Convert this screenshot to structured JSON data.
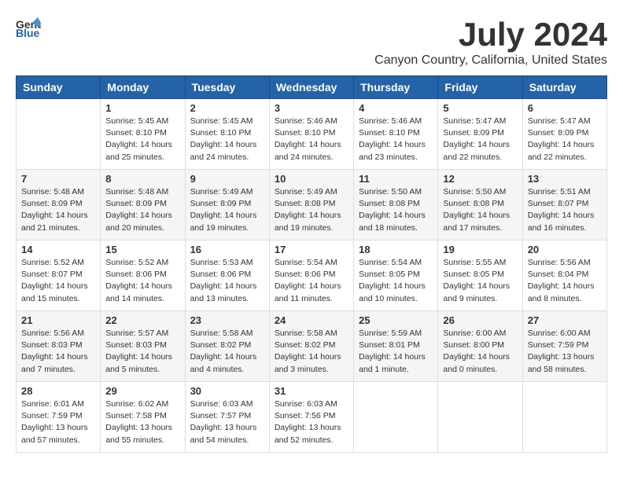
{
  "header": {
    "logo": {
      "line1": "General",
      "line2": "Blue"
    },
    "title": "July 2024",
    "subtitle": "Canyon Country, California, United States"
  },
  "days_of_week": [
    "Sunday",
    "Monday",
    "Tuesday",
    "Wednesday",
    "Thursday",
    "Friday",
    "Saturday"
  ],
  "weeks": [
    [
      {
        "day": "",
        "info": ""
      },
      {
        "day": "1",
        "info": "Sunrise: 5:45 AM\nSunset: 8:10 PM\nDaylight: 14 hours\nand 25 minutes."
      },
      {
        "day": "2",
        "info": "Sunrise: 5:45 AM\nSunset: 8:10 PM\nDaylight: 14 hours\nand 24 minutes."
      },
      {
        "day": "3",
        "info": "Sunrise: 5:46 AM\nSunset: 8:10 PM\nDaylight: 14 hours\nand 24 minutes."
      },
      {
        "day": "4",
        "info": "Sunrise: 5:46 AM\nSunset: 8:10 PM\nDaylight: 14 hours\nand 23 minutes."
      },
      {
        "day": "5",
        "info": "Sunrise: 5:47 AM\nSunset: 8:09 PM\nDaylight: 14 hours\nand 22 minutes."
      },
      {
        "day": "6",
        "info": "Sunrise: 5:47 AM\nSunset: 8:09 PM\nDaylight: 14 hours\nand 22 minutes."
      }
    ],
    [
      {
        "day": "7",
        "info": "Sunrise: 5:48 AM\nSunset: 8:09 PM\nDaylight: 14 hours\nand 21 minutes."
      },
      {
        "day": "8",
        "info": "Sunrise: 5:48 AM\nSunset: 8:09 PM\nDaylight: 14 hours\nand 20 minutes."
      },
      {
        "day": "9",
        "info": "Sunrise: 5:49 AM\nSunset: 8:09 PM\nDaylight: 14 hours\nand 19 minutes."
      },
      {
        "day": "10",
        "info": "Sunrise: 5:49 AM\nSunset: 8:08 PM\nDaylight: 14 hours\nand 19 minutes."
      },
      {
        "day": "11",
        "info": "Sunrise: 5:50 AM\nSunset: 8:08 PM\nDaylight: 14 hours\nand 18 minutes."
      },
      {
        "day": "12",
        "info": "Sunrise: 5:50 AM\nSunset: 8:08 PM\nDaylight: 14 hours\nand 17 minutes."
      },
      {
        "day": "13",
        "info": "Sunrise: 5:51 AM\nSunset: 8:07 PM\nDaylight: 14 hours\nand 16 minutes."
      }
    ],
    [
      {
        "day": "14",
        "info": "Sunrise: 5:52 AM\nSunset: 8:07 PM\nDaylight: 14 hours\nand 15 minutes."
      },
      {
        "day": "15",
        "info": "Sunrise: 5:52 AM\nSunset: 8:06 PM\nDaylight: 14 hours\nand 14 minutes."
      },
      {
        "day": "16",
        "info": "Sunrise: 5:53 AM\nSunset: 8:06 PM\nDaylight: 14 hours\nand 13 minutes."
      },
      {
        "day": "17",
        "info": "Sunrise: 5:54 AM\nSunset: 8:06 PM\nDaylight: 14 hours\nand 11 minutes."
      },
      {
        "day": "18",
        "info": "Sunrise: 5:54 AM\nSunset: 8:05 PM\nDaylight: 14 hours\nand 10 minutes."
      },
      {
        "day": "19",
        "info": "Sunrise: 5:55 AM\nSunset: 8:05 PM\nDaylight: 14 hours\nand 9 minutes."
      },
      {
        "day": "20",
        "info": "Sunrise: 5:56 AM\nSunset: 8:04 PM\nDaylight: 14 hours\nand 8 minutes."
      }
    ],
    [
      {
        "day": "21",
        "info": "Sunrise: 5:56 AM\nSunset: 8:03 PM\nDaylight: 14 hours\nand 7 minutes."
      },
      {
        "day": "22",
        "info": "Sunrise: 5:57 AM\nSunset: 8:03 PM\nDaylight: 14 hours\nand 5 minutes."
      },
      {
        "day": "23",
        "info": "Sunrise: 5:58 AM\nSunset: 8:02 PM\nDaylight: 14 hours\nand 4 minutes."
      },
      {
        "day": "24",
        "info": "Sunrise: 5:58 AM\nSunset: 8:02 PM\nDaylight: 14 hours\nand 3 minutes."
      },
      {
        "day": "25",
        "info": "Sunrise: 5:59 AM\nSunset: 8:01 PM\nDaylight: 14 hours\nand 1 minute."
      },
      {
        "day": "26",
        "info": "Sunrise: 6:00 AM\nSunset: 8:00 PM\nDaylight: 14 hours\nand 0 minutes."
      },
      {
        "day": "27",
        "info": "Sunrise: 6:00 AM\nSunset: 7:59 PM\nDaylight: 13 hours\nand 58 minutes."
      }
    ],
    [
      {
        "day": "28",
        "info": "Sunrise: 6:01 AM\nSunset: 7:59 PM\nDaylight: 13 hours\nand 57 minutes."
      },
      {
        "day": "29",
        "info": "Sunrise: 6:02 AM\nSunset: 7:58 PM\nDaylight: 13 hours\nand 55 minutes."
      },
      {
        "day": "30",
        "info": "Sunrise: 6:03 AM\nSunset: 7:57 PM\nDaylight: 13 hours\nand 54 minutes."
      },
      {
        "day": "31",
        "info": "Sunrise: 6:03 AM\nSunset: 7:56 PM\nDaylight: 13 hours\nand 52 minutes."
      },
      {
        "day": "",
        "info": ""
      },
      {
        "day": "",
        "info": ""
      },
      {
        "day": "",
        "info": ""
      }
    ]
  ]
}
